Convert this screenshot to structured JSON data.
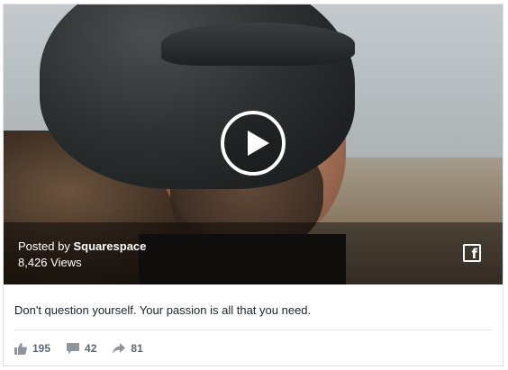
{
  "post": {
    "posted_by_prefix": "Posted by",
    "author": "Squarespace",
    "views": "8,426 Views",
    "caption": "Don't question yourself. Your passion is all that you need."
  },
  "stats": {
    "likes": "195",
    "comments": "42",
    "shares": "81"
  },
  "icons": {
    "play": "play-icon",
    "facebook": "facebook-icon",
    "like": "thumbs-up-icon",
    "comment": "comment-icon",
    "share": "share-arrow-icon"
  },
  "colors": {
    "text_primary": "#1d2129",
    "text_secondary": "#606770",
    "border": "#dddfe2"
  }
}
